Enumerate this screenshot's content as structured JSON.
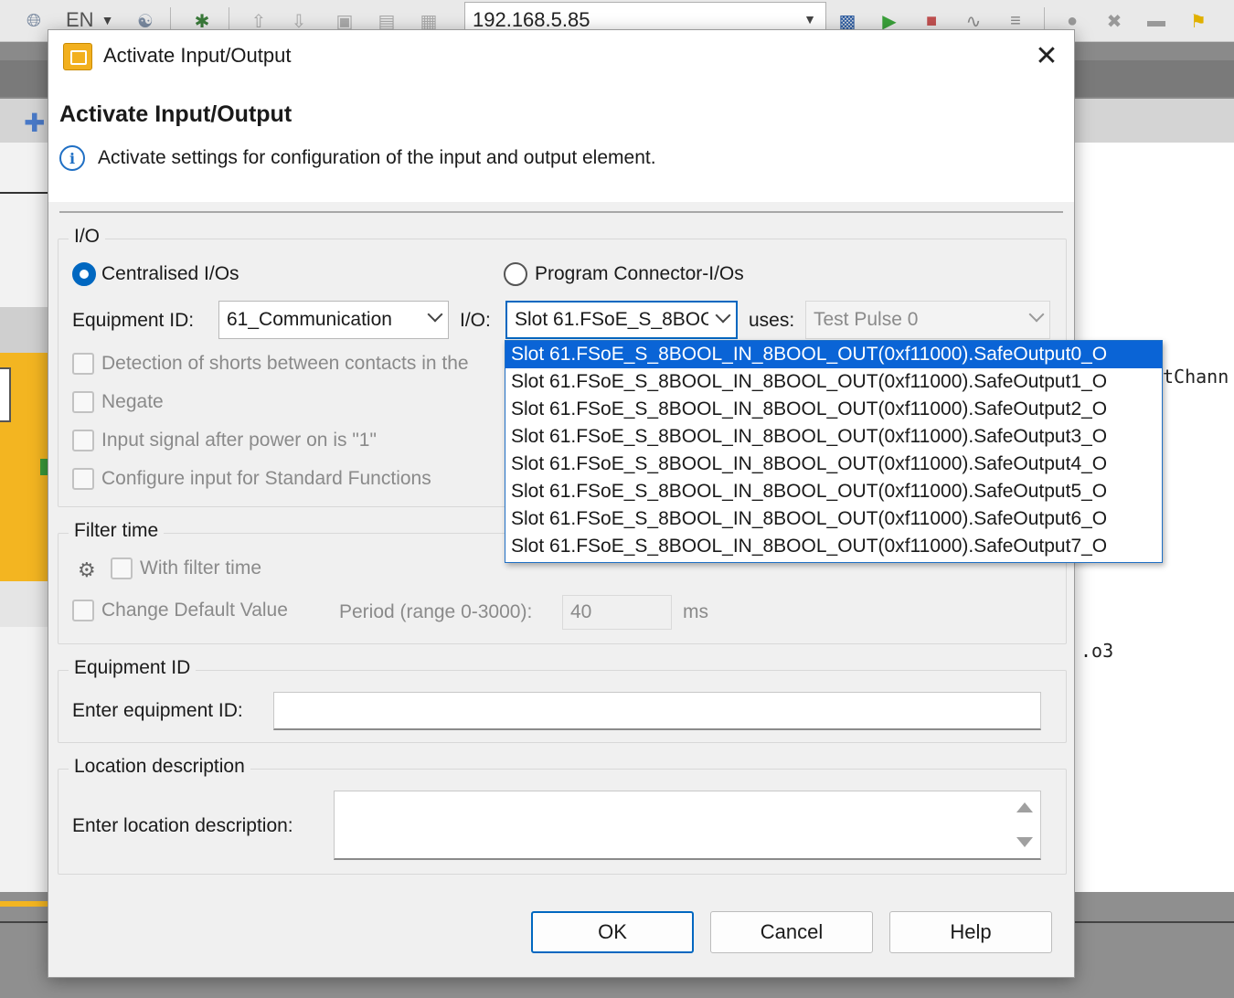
{
  "toolbar": {
    "language": "EN",
    "ip_address": "192.168.5.85",
    "icons": [
      "globe-icon",
      "network-icon",
      "bug-icon",
      "upload-icon",
      "download-icon",
      "folder-icon",
      "folder-up-icon",
      "device-icon",
      "monitor-icon",
      "play-icon",
      "stop-icon",
      "signal-icon",
      "list-icon",
      "user-icon",
      "user-remove-icon",
      "panel-icon",
      "key-icon"
    ]
  },
  "background": {
    "code_fragment_1": "tChann",
    "code_fragment_2": ".o3"
  },
  "dialog": {
    "title": "Activate Input/Output",
    "header_title": "Activate Input/Output",
    "header_description": "Activate settings for configuration of the input and output element.",
    "io_group": {
      "label": "I/O",
      "radio_centralised": "Centralised I/Os",
      "radio_program_connector": "Program Connector-I/Os",
      "equipment_id_label": "Equipment ID:",
      "equipment_id_value": "61_Communication",
      "io_label": "I/O:",
      "io_value": "Slot 61.FSoE_S_8BOOL_IN_8BOOL_OUT(0xf11000).SafeOutput0_O",
      "uses_label": "uses:",
      "uses_value": "Test Pulse 0",
      "check_shorts": "Detection of shorts between contacts in the",
      "check_negate": "Negate",
      "check_power_on": "Input signal after power on is \"1\"",
      "check_standard": "Configure input for Standard Functions"
    },
    "io_dropdown": [
      "Slot 61.FSoE_S_8BOOL_IN_8BOOL_OUT(0xf11000).SafeOutput0_O",
      "Slot 61.FSoE_S_8BOOL_IN_8BOOL_OUT(0xf11000).SafeOutput1_O",
      "Slot 61.FSoE_S_8BOOL_IN_8BOOL_OUT(0xf11000).SafeOutput2_O",
      "Slot 61.FSoE_S_8BOOL_IN_8BOOL_OUT(0xf11000).SafeOutput3_O",
      "Slot 61.FSoE_S_8BOOL_IN_8BOOL_OUT(0xf11000).SafeOutput4_O",
      "Slot 61.FSoE_S_8BOOL_IN_8BOOL_OUT(0xf11000).SafeOutput5_O",
      "Slot 61.FSoE_S_8BOOL_IN_8BOOL_OUT(0xf11000).SafeOutput6_O",
      "Slot 61.FSoE_S_8BOOL_IN_8BOOL_OUT(0xf11000).SafeOutput7_O"
    ],
    "filter_group": {
      "label": "Filter time",
      "with_filter": "With filter time",
      "change_default": "Change Default Value",
      "period_label": "Period (range 0-3000):",
      "period_value": "40",
      "unit": "ms"
    },
    "equipment_group": {
      "label": "Equipment ID",
      "field_label": "Enter equipment ID:",
      "field_value": ""
    },
    "location_group": {
      "label": "Location description",
      "field_label": "Enter location description:",
      "field_value": ""
    },
    "buttons": {
      "ok": "OK",
      "cancel": "Cancel",
      "help": "Help"
    }
  },
  "colors": {
    "accent": "#0067c0",
    "selection": "#0a64d6",
    "app_yellow": "#f3b521"
  }
}
